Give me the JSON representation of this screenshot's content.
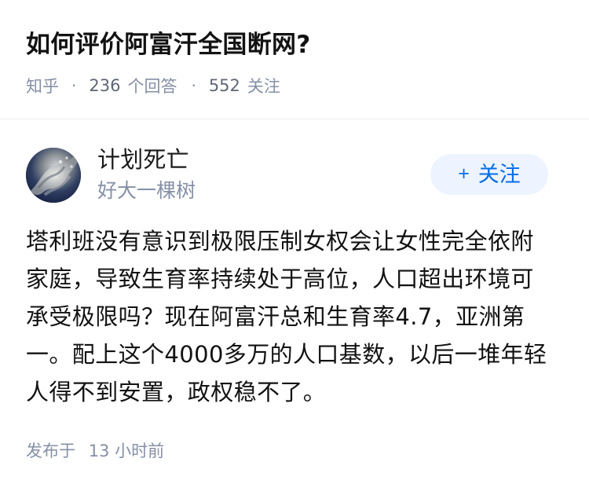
{
  "question": {
    "title": "如何评价阿富汗全国断网?",
    "source": "知乎",
    "separator": "·",
    "answer_count": "236",
    "answer_label": "个回答",
    "follower_count": "552",
    "follower_label": "关注"
  },
  "answer": {
    "author": {
      "name": "计划死亡",
      "bio": "好大一棵树",
      "avatar_icon": "avatar-image"
    },
    "follow_button": {
      "icon": "+",
      "label": "关注"
    },
    "body": "塔利班没有意识到极限压制女权会让女性完全依附\n家庭，导致生育率持续处于高位，人口超出环境可\n承受极限吗？现在阿富汗总和生育率4.7，亚洲第\n一。配上这个4000多万的人口基数，以后一堆年轻\n人得不到安置，政权稳不了。",
    "published_prefix": "发布于",
    "published_time": "13 小时前"
  },
  "colors": {
    "accent": "#056de8",
    "muted": "#8590a6",
    "text": "#121212",
    "follow_bg": "#eef4ff"
  }
}
